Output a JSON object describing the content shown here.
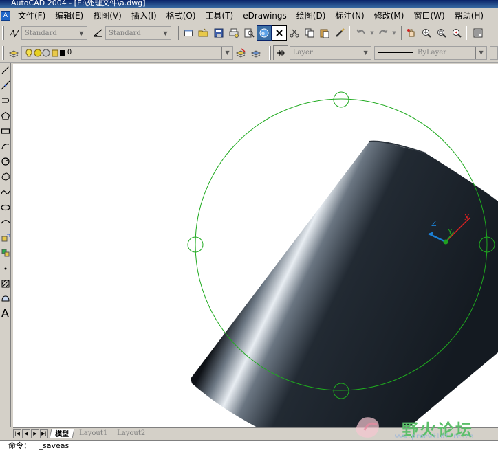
{
  "window": {
    "title": "AutoCAD 2004 - [E:\\处理文件\\a.dwg]"
  },
  "menu": [
    "文件(F)",
    "编辑(E)",
    "视图(V)",
    "插入(I)",
    "格式(O)",
    "工具(T)",
    "eDrawings",
    "绘图(D)",
    "标注(N)",
    "修改(M)",
    "窗口(W)",
    "帮助(H)"
  ],
  "styles": {
    "text_style": "Standard",
    "dim_style": "Standard"
  },
  "layers": {
    "current_layer": "0",
    "layer_combo": "Layer",
    "linetype_combo": "ByLayer"
  },
  "drawing_tools": [
    "line-icon",
    "construction-line-icon",
    "polyline-icon",
    "polygon-icon",
    "rectangle-icon",
    "arc-icon",
    "circle-icon",
    "revision-cloud-icon",
    "spline-icon",
    "ellipse-icon",
    "ellipse-arc-icon",
    "insert-block-icon",
    "make-block-icon",
    "point-icon",
    "hatch-icon",
    "region-icon",
    "multiline-text-icon"
  ],
  "multiline_text_glyph": "A",
  "tabs": {
    "model": "模型",
    "layout1": "Layout1",
    "layout2": "Layout2"
  },
  "ucs": {
    "x": "X",
    "y": "Y",
    "z": "Z"
  },
  "command": {
    "prompt": "命令：",
    "last": "_saveas"
  },
  "watermark": {
    "title": "野火论坛",
    "url": "www.proewildfire.cn"
  },
  "colors": {
    "grip_green": "#1faa1f",
    "ucs_x": "#e02020",
    "ucs_y": "#20a020",
    "ucs_z": "#1b7fd4",
    "solid": "#1d2228"
  }
}
